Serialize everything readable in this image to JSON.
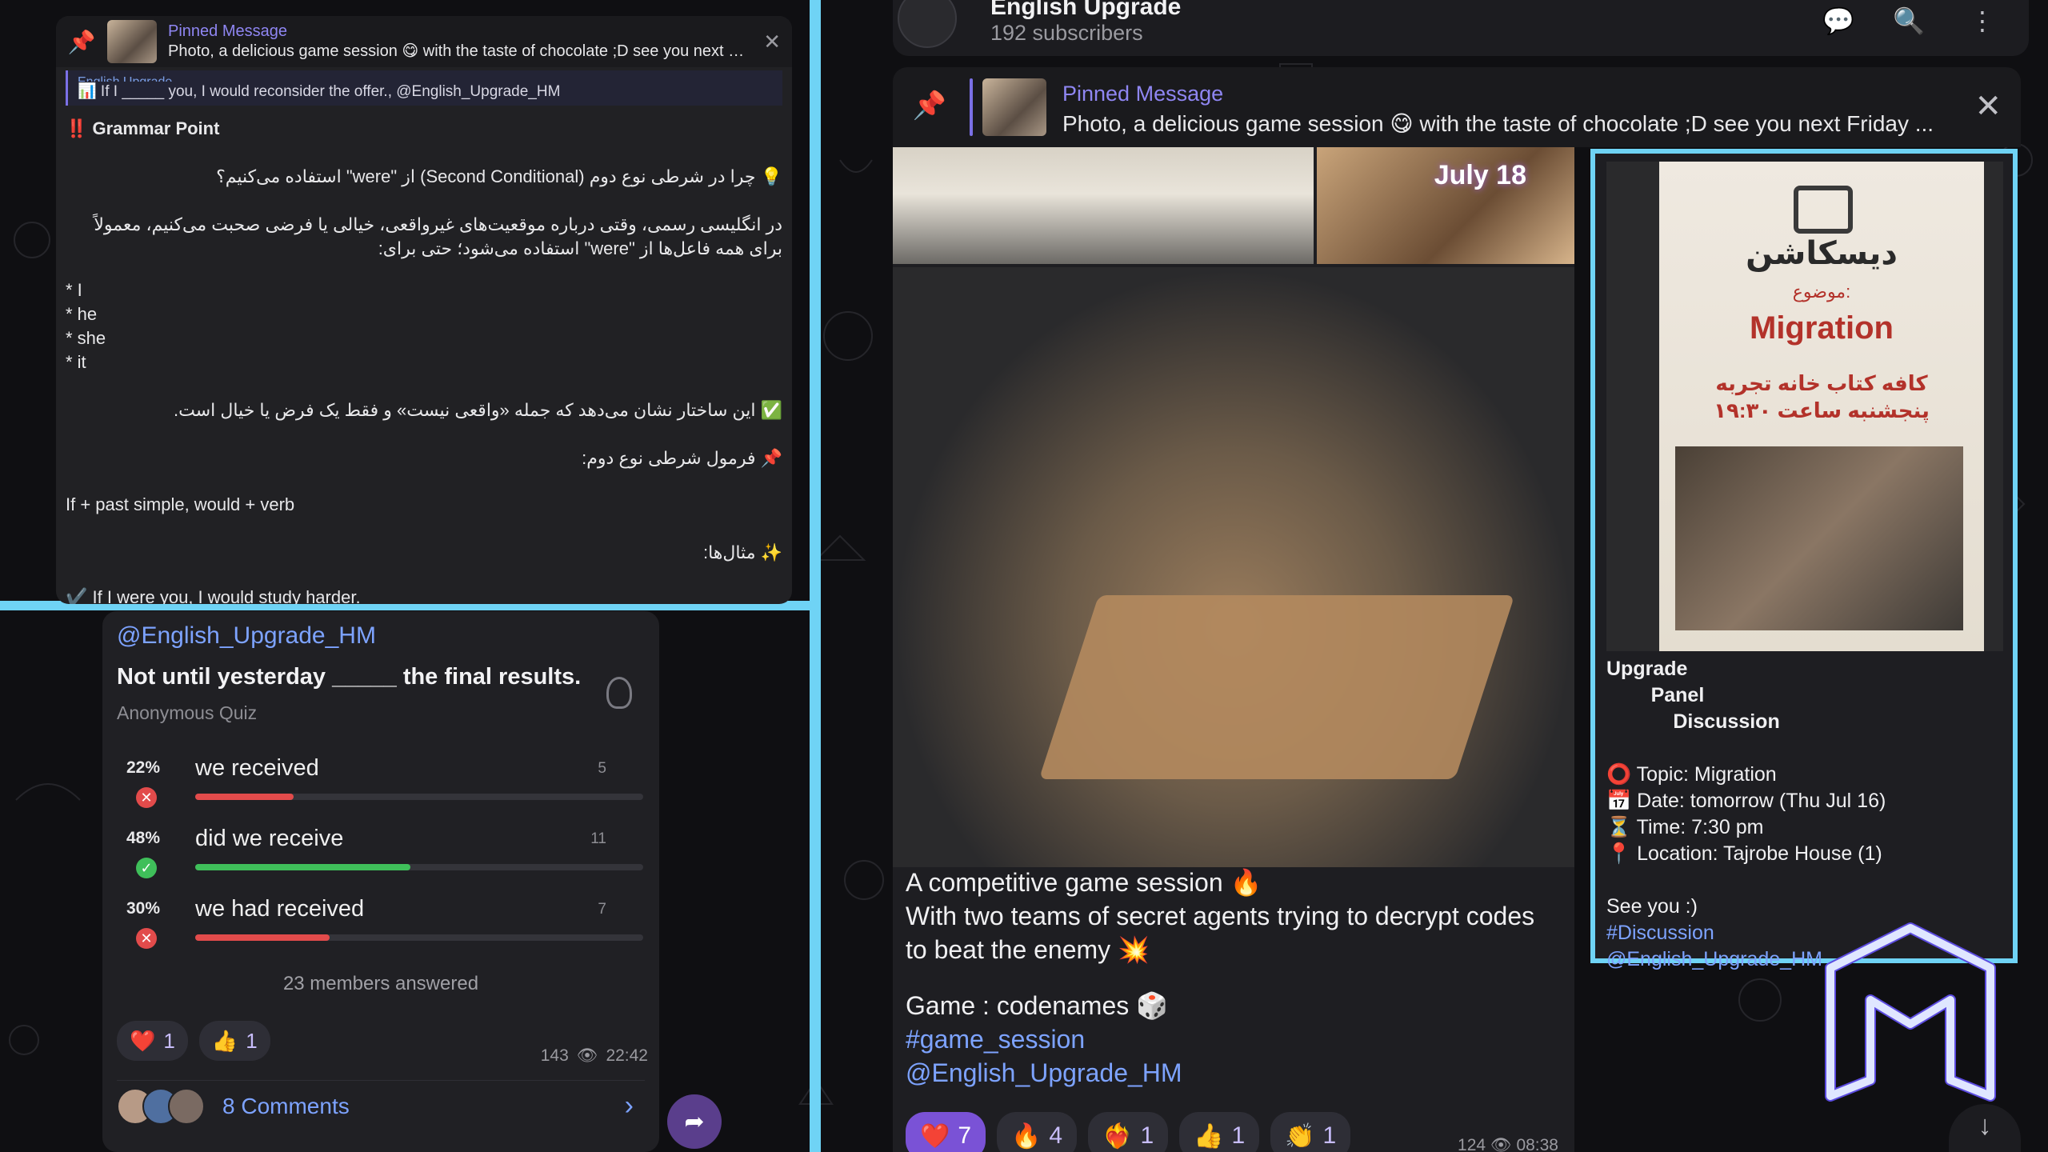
{
  "left_post": {
    "pinned_title": "Pinned Message",
    "pinned_text": "Photo, a delicious game session 😋 with the taste of chocolate ;D see you next Friday ...",
    "reply_name": "English Upgrade",
    "reply_text": "📊 If I _____ you, I would reconsider the offer., @English_Upgrade_HM",
    "heading": "‼️ Grammar Point",
    "fa_question": "💡 چرا در شرطی نوع دوم (Second Conditional) از \"were\" استفاده می‌کنیم؟",
    "fa_explain_1": "در انگلیسی رسمی، وقتی درباره موقعیت‌های غیرواقعی، خیالی یا فرضی صحبت می‌کنیم، معمولاً",
    "fa_explain_2": "برای همه فاعل‌ها از \"were\" استفاده می‌شود؛ حتی برای:",
    "subjects": [
      "* I",
      "* he",
      "* she",
      "* it"
    ],
    "fa_note": "✅ این ساختار نشان می‌دهد که جمله «واقعی نیست» و فقط یک فرض یا خیال است.",
    "fa_formula": "📌 فرمول شرطی نوع دوم:",
    "formula": "If + past simple, would + verb",
    "fa_examples": "✨ مثال‌ها:",
    "example_1": "✔️ If I were you, I would study harder."
  },
  "quiz": {
    "channel_tag": "@English_Upgrade_HM",
    "question": "Not until yesterday _____ the final results.",
    "type": "Anonymous Quiz",
    "options": [
      {
        "pct": "22%",
        "text": "we received",
        "count": "5",
        "fraction": 0.22,
        "correct": false
      },
      {
        "pct": "48%",
        "text": "did we receive",
        "count": "11",
        "fraction": 0.48,
        "correct": true
      },
      {
        "pct": "30%",
        "text": "we had received",
        "count": "7",
        "fraction": 0.3,
        "correct": false
      }
    ],
    "answered": "23 members answered",
    "reactions": [
      {
        "emoji": "❤️",
        "count": "1"
      },
      {
        "emoji": "👍",
        "count": "1"
      }
    ],
    "views": "143",
    "time": "22:42",
    "comments": "8 Comments"
  },
  "channel": {
    "name": "English Upgrade",
    "subscribers": "192 subscribers",
    "pinned_title": "Pinned Message",
    "pinned_text": "Photo, a delicious game session 😋 with the taste of chocolate ;D see you next Friday ...",
    "photo_date": "July 18"
  },
  "post": {
    "line1": "A competitive game session 🔥",
    "line2": "With two teams of secret agents trying to decrypt codes to beat the enemy 💥",
    "line3": "Game : codenames 🎲",
    "hashtag": "#game_session",
    "mention": "@English_Upgrade_HM",
    "reactions": [
      {
        "emoji": "❤️",
        "count": "7",
        "active": true
      },
      {
        "emoji": "🔥",
        "count": "4"
      },
      {
        "emoji": "❤️‍🔥",
        "count": "1"
      },
      {
        "emoji": "👍",
        "count": "1"
      },
      {
        "emoji": "👏",
        "count": "1"
      }
    ],
    "views": "124",
    "time": "08:38"
  },
  "poster": {
    "title_fa": "دیسکاشن",
    "topic_label_fa": "موضوع:",
    "topic": "Migration",
    "cafe_fa": "کافه کتاب خانه تجربه",
    "time_fa": "پنجشنبه ساعت ۱۹:۳۰",
    "text_lines": [
      "Upgrade",
      "        Panel",
      "            Discussion",
      "",
      "⭕ Topic: Migration",
      "📅 Date: tomorrow (Thu Jul 16)",
      "⏳ Time: 7:30 pm",
      "📍 Location: Tajrobe House (1)",
      "",
      "See you :)"
    ],
    "hashtag": "#Discussion",
    "mention": "@English_Upgrade_HM"
  },
  "colors": {
    "accent_cyan": "#6fd3f5",
    "link_blue": "#7da3ff",
    "purple": "#8f86f2",
    "wrong": "#e24b4b",
    "right": "#3fbf5a"
  },
  "icons": [
    "pin-icon",
    "search-icon",
    "more-icon",
    "discussion-icon",
    "close-icon",
    "bulb-icon",
    "eye-icon",
    "share-icon",
    "chevron-right-icon",
    "arrow-down-icon"
  ]
}
